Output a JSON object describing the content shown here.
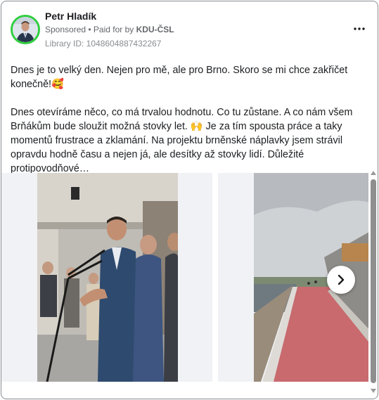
{
  "post": {
    "author": "Petr Hladík",
    "sponsored": "Sponsored",
    "paid_for_prefix": "• Paid for by",
    "paid_for_by": "KDU-ČSL",
    "library_id": "Library ID: 1048604887432267",
    "paragraph1": "Dnes je to velký den. Nejen pro mě, ale pro Brno. Skoro se mi chce zakřičet konečně!🥰",
    "paragraph2": "Dnes otevíráme něco, co má trvalou hodnotu. Co tu zůstane. A co nám všem Brňákům bude sloužit možná stovky let. 🙌 Je za tím spousta práce a taky momentů frustrace a zklamání. Na projektu brněnské náplavky jsem strávil opravdu hodně času a nejen já, ale desítky až stovky lidí. Důležité protipovodňové…"
  },
  "icons": {
    "more": "more-horizontal-icon",
    "next": "chevron-right-icon"
  },
  "colors": {
    "avatar_ring": "#2fce3f",
    "secondary_text": "#65676b"
  }
}
